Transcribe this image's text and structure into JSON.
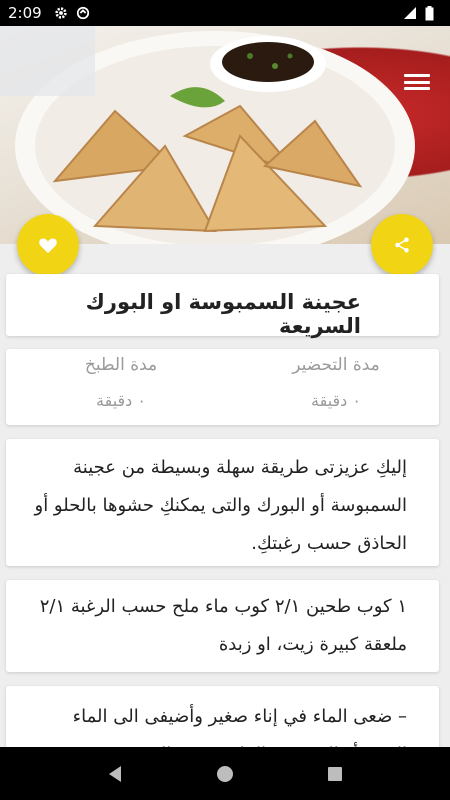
{
  "status_bar": {
    "time": "2:09",
    "icons": [
      "gear-icon",
      "data-saver-icon",
      "signal-icon",
      "battery-icon"
    ]
  },
  "hero": {
    "image_subject": "samosa-plate-photo",
    "menu_icon": "hamburger-menu-icon"
  },
  "actions": {
    "favorite_icon": "heart-icon",
    "share_icon": "share-icon",
    "accent_color": "#f1d515"
  },
  "recipe": {
    "title": "عجينة السمبوسة او البورك السريعة",
    "prep_label": "مدة التحضير",
    "prep_value": "٠ دقيقة",
    "cook_label": "مدة الطبخ",
    "cook_value": "٠ دقيقة",
    "intro": "إليكِ عزيزتى طريقة سهلة وبسيطة من عجينة السمبوسة أو البورك والتى يمكنكِ حشوها بالحلو أو الحاذق حسب رغبتكِ.",
    "ingredients": "١ كوب طحين ٢/١ كوب ماء ملح حسب الرغبة ٢/١ ملعقة كبيرة زيت، او زبدة",
    "step": "– ضعى الماء في إناء صغير وأضيفى الى الماء الزيت أو الزبدة ثم الملح حسب الرغبة"
  },
  "nav": {
    "back_icon": "back-triangle-icon",
    "home_icon": "home-circle-icon",
    "recents_icon": "recents-square-icon"
  }
}
